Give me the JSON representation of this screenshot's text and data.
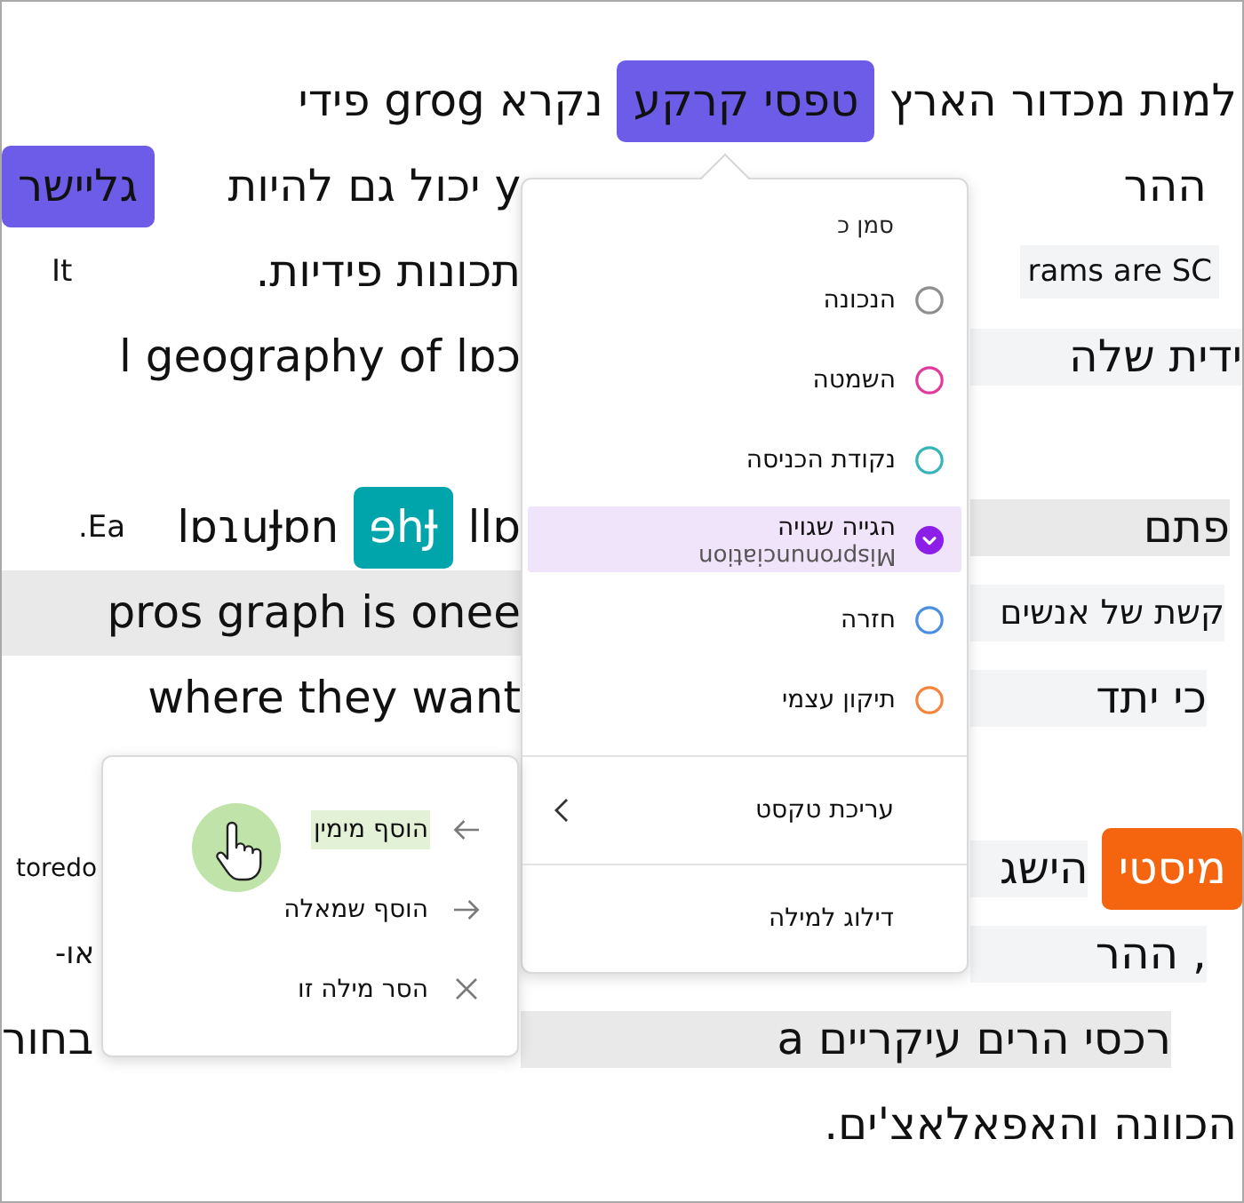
{
  "document": {
    "lines": [
      {
        "right": [
          {
            "text": "למות מכדור הארץ",
            "kind": "plain"
          },
          {
            "text": "טפסי קרקע",
            "kind": "chip",
            "color": "#6c5ce7",
            "light_text": false
          },
          {
            "text": "נקרא grog פידי",
            "kind": "plain"
          }
        ]
      },
      {
        "left": [
          {
            "text": "y יכול גם להיות",
            "kind": "plain"
          },
          {
            "text": "גליישר",
            "kind": "chip",
            "color": "#6c5ce7",
            "light_text": false
          }
        ],
        "right": [
          {
            "text": "ההר",
            "kind": "plain"
          }
        ]
      },
      {
        "left": [
          {
            "text": "תכונות פידיות.",
            "kind": "plain"
          },
          {
            "text": "It",
            "kind": "plain"
          }
        ],
        "right": [
          {
            "text": "rams are SC",
            "kind": "shaded"
          }
        ]
      },
      {
        "left": [
          {
            "text": "lɒɔ",
            "kind": "plain"
          },
          {
            "text": "l geography of",
            "kind": "plain"
          }
        ],
        "right": [
          {
            "text": "ידית שלה",
            "kind": "shaded"
          }
        ]
      },
      {
        "left": [
          {
            "text": "llɒ",
            "kind": "plain"
          },
          {
            "text": "ɘhɈ",
            "kind": "chip",
            "color": "#00a5ac",
            "light_text": true
          },
          {
            "text": "lɒɿuɈɒn",
            "kind": "plain"
          },
          {
            "text": "Ea.",
            "kind": "plain"
          }
        ],
        "right": [
          {
            "text": "פתם",
            "kind": "band"
          }
        ]
      },
      {
        "left": [
          {
            "text": "pros graph is onee",
            "kind": "band"
          }
        ],
        "right": [
          {
            "text": "קשת של אנשים",
            "kind": "shaded"
          }
        ]
      },
      {
        "left": [
          {
            "text": "where they want",
            "kind": "plain"
          }
        ],
        "right": [
          {
            "text": "כי יתד",
            "kind": "shaded"
          }
        ]
      },
      {
        "left": [
          {
            "text": "toredo",
            "kind": "plain"
          }
        ],
        "right": [
          {
            "text": "מיסטי",
            "kind": "chip",
            "color": "#f5650f",
            "light_text": true
          },
          {
            "text": "הישג",
            "kind": "shaded"
          }
        ]
      },
      {
        "left": [
          {
            "text": "או-",
            "kind": "plain"
          }
        ],
        "right": [
          {
            "text": ", ההר",
            "kind": "shaded"
          }
        ]
      },
      {
        "left": [
          {
            "text": "בחור",
            "kind": "plain"
          }
        ],
        "right": [
          {
            "text": "רכסי הרים עיקריים a",
            "kind": "band"
          }
        ]
      },
      {
        "right": [
          {
            "text": "הכוונה והאפאלאצ'ים.",
            "kind": "plain"
          }
        ]
      }
    ]
  },
  "main_menu": {
    "heading": "סמן כ",
    "categories": [
      {
        "label": "הנכונה",
        "color": "#8e8e8e",
        "selected": false
      },
      {
        "label": "השמטה",
        "color": "#e3399e",
        "selected": false
      },
      {
        "label": "נקודת הכניסה",
        "color": "#36b5b8",
        "selected": false
      },
      {
        "label": "הגייה שגויה",
        "color": "#8c1ee8",
        "selected": true,
        "flipped_text": "Mispronunciation"
      },
      {
        "label": "חזרה",
        "color": "#4a8fe0",
        "selected": false
      },
      {
        "label": "תיקון עצמי",
        "color": "#f5843d",
        "selected": false
      }
    ],
    "actions": [
      {
        "label": "עריכת טקסט",
        "kind": "submenu",
        "expanded": true,
        "items": [
          {
            "label": "הוסף מימין",
            "kind": "prepend",
            "highlighted": true
          },
          {
            "label": "הוסף שמאלה",
            "kind": "append",
            "highlighted": false
          },
          {
            "label": "הסר מילה זו",
            "kind": "remove",
            "highlighted": false
          }
        ]
      },
      {
        "label": "דילוג למילה",
        "kind": "command"
      }
    ]
  }
}
